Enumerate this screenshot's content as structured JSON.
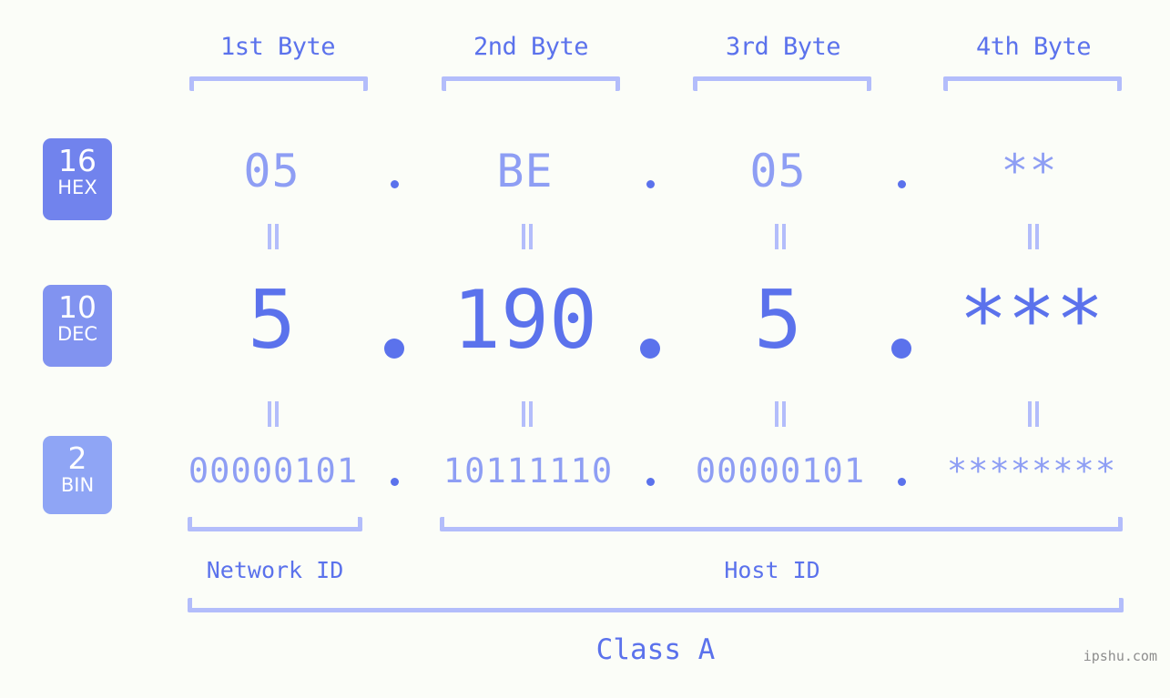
{
  "meta": {
    "background": "#fbfdf8",
    "accent": "#5b72ec",
    "accent_light": "#8e9ef4",
    "bracket_color": "#b3bdfb"
  },
  "headers": [
    {
      "label": "1st Byte"
    },
    {
      "label": "2nd Byte"
    },
    {
      "label": "3rd Byte"
    },
    {
      "label": "4th Byte"
    }
  ],
  "radix_badges": [
    {
      "number": "16",
      "system": "HEX",
      "color": "#7183ed"
    },
    {
      "number": "10",
      "system": "DEC",
      "color": "#8193f0"
    },
    {
      "number": "2",
      "system": "BIN",
      "color": "#8fa5f5"
    }
  ],
  "rows": {
    "hex": {
      "radix": "16",
      "system": "HEX",
      "bytes": [
        "05",
        "BE",
        "05",
        "**"
      ],
      "separator": "."
    },
    "dec": {
      "radix": "10",
      "system": "DEC",
      "bytes": [
        "5",
        "190",
        "5",
        "***"
      ],
      "separator": "."
    },
    "bin": {
      "radix": "2",
      "system": "BIN",
      "bytes": [
        "00000101",
        "10111110",
        "00000101",
        "********"
      ],
      "separator": "."
    }
  },
  "equals_marker": "=",
  "id_labels": {
    "network": "Network ID",
    "host": "Host ID"
  },
  "class_label": "Class A",
  "watermark": "ipshu.com",
  "chart_data": {
    "type": "table",
    "title": "Class A",
    "categories": [
      "1st Byte",
      "2nd Byte",
      "3rd Byte",
      "4th Byte"
    ],
    "series": [
      {
        "name": "HEX",
        "values": [
          "05",
          "BE",
          "05",
          "**"
        ]
      },
      {
        "name": "DEC",
        "values": [
          "5",
          "190",
          "5",
          "***"
        ]
      },
      {
        "name": "BIN",
        "values": [
          "00000101",
          "10111110",
          "00000101",
          "********"
        ]
      }
    ],
    "annotations": [
      "Network ID",
      "Host ID",
      "Class A"
    ]
  }
}
